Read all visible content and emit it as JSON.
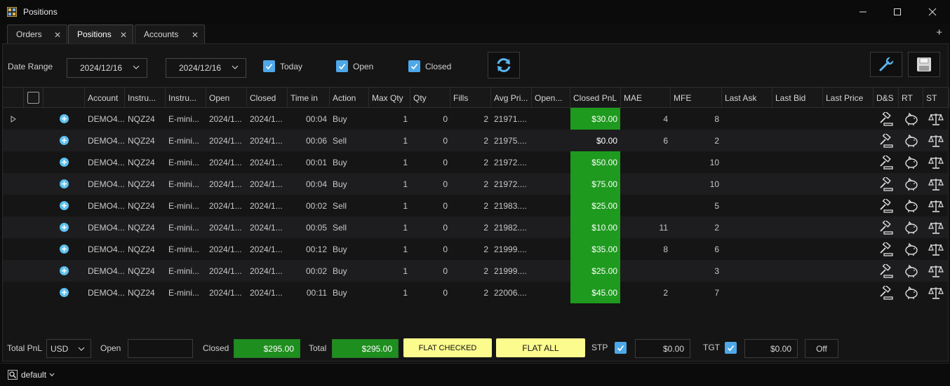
{
  "window": {
    "title": "Positions"
  },
  "tabs": [
    {
      "label": "Orders"
    },
    {
      "label": "Positions"
    },
    {
      "label": "Accounts"
    }
  ],
  "toolbar": {
    "date_range_label": "Date Range",
    "date_from": "2024/12/16",
    "date_to": "2024/12/16",
    "today_label": "Today",
    "open_label": "Open",
    "closed_label": "Closed"
  },
  "columns": [
    "Account",
    "Instru...",
    "Instru...",
    "Open",
    "Closed",
    "Time in",
    "Action",
    "Max Qty",
    "Qty",
    "Fills",
    "Avg Pri...",
    "Open...",
    "Closed PnL",
    "MAE",
    "MFE",
    "Last Ask",
    "Last Bid",
    "Last Price",
    "D&S",
    "RT",
    "ST"
  ],
  "rows": [
    {
      "account": "DEMO4...",
      "instrument": "NQZ24",
      "instrument_name": "E-mini...",
      "open": "2024/1...",
      "closed": "2024/1...",
      "time_in": "00:04",
      "action": "Buy",
      "max_qty": "1",
      "qty": "0",
      "fills": "2",
      "avg_price": "21971....",
      "closed_pnl": "$30.00",
      "mae": "4",
      "mfe": "8",
      "pnl_positive": true
    },
    {
      "account": "DEMO4...",
      "instrument": "NQZ24",
      "instrument_name": "E-mini...",
      "open": "2024/1...",
      "closed": "2024/1...",
      "time_in": "00:06",
      "action": "Sell",
      "max_qty": "1",
      "qty": "0",
      "fills": "2",
      "avg_price": "21975....",
      "closed_pnl": "$0.00",
      "mae": "6",
      "mfe": "2",
      "pnl_positive": false
    },
    {
      "account": "DEMO4...",
      "instrument": "NQZ24",
      "instrument_name": "E-mini...",
      "open": "2024/1...",
      "closed": "2024/1...",
      "time_in": "00:01",
      "action": "Buy",
      "max_qty": "1",
      "qty": "0",
      "fills": "2",
      "avg_price": "21972....",
      "closed_pnl": "$50.00",
      "mae": "",
      "mfe": "10",
      "pnl_positive": true
    },
    {
      "account": "DEMO4...",
      "instrument": "NQZ24",
      "instrument_name": "E-mini...",
      "open": "2024/1...",
      "closed": "2024/1...",
      "time_in": "00:04",
      "action": "Buy",
      "max_qty": "1",
      "qty": "0",
      "fills": "2",
      "avg_price": "21972....",
      "closed_pnl": "$75.00",
      "mae": "",
      "mfe": "10",
      "pnl_positive": true
    },
    {
      "account": "DEMO4...",
      "instrument": "NQZ24",
      "instrument_name": "E-mini...",
      "open": "2024/1...",
      "closed": "2024/1...",
      "time_in": "00:02",
      "action": "Sell",
      "max_qty": "1",
      "qty": "0",
      "fills": "2",
      "avg_price": "21983....",
      "closed_pnl": "$25.00",
      "mae": "",
      "mfe": "5",
      "pnl_positive": true
    },
    {
      "account": "DEMO4...",
      "instrument": "NQZ24",
      "instrument_name": "E-mini...",
      "open": "2024/1...",
      "closed": "2024/1...",
      "time_in": "00:05",
      "action": "Sell",
      "max_qty": "1",
      "qty": "0",
      "fills": "2",
      "avg_price": "21982....",
      "closed_pnl": "$10.00",
      "mae": "11",
      "mfe": "2",
      "pnl_positive": true
    },
    {
      "account": "DEMO4...",
      "instrument": "NQZ24",
      "instrument_name": "E-mini...",
      "open": "2024/1...",
      "closed": "2024/1...",
      "time_in": "00:12",
      "action": "Buy",
      "max_qty": "1",
      "qty": "0",
      "fills": "2",
      "avg_price": "21999....",
      "closed_pnl": "$35.00",
      "mae": "8",
      "mfe": "6",
      "pnl_positive": true
    },
    {
      "account": "DEMO4...",
      "instrument": "NQZ24",
      "instrument_name": "E-mini...",
      "open": "2024/1...",
      "closed": "2024/1...",
      "time_in": "00:02",
      "action": "Buy",
      "max_qty": "1",
      "qty": "0",
      "fills": "2",
      "avg_price": "21999....",
      "closed_pnl": "$25.00",
      "mae": "",
      "mfe": "3",
      "pnl_positive": true
    },
    {
      "account": "DEMO4...",
      "instrument": "NQZ24",
      "instrument_name": "E-mini...",
      "open": "2024/1...",
      "closed": "2024/1...",
      "time_in": "00:11",
      "action": "Buy",
      "max_qty": "1",
      "qty": "0",
      "fills": "2",
      "avg_price": "22006....",
      "closed_pnl": "$45.00",
      "mae": "2",
      "mfe": "7",
      "pnl_positive": true
    }
  ],
  "row_icons": [
    "gavel-icon",
    "piggy-bank-icon",
    "scales-icon"
  ],
  "footer": {
    "total_pnl_label": "Total PnL",
    "currency": "USD",
    "open_label": "Open",
    "open_value": "",
    "closed_label": "Closed",
    "closed_value": "$295.00",
    "total_label": "Total",
    "total_value": "$295.00",
    "flat_checked_label": "FLAT CHECKED",
    "flat_all_label": "FLAT ALL",
    "stp_label": "STP",
    "stp_value": "$0.00",
    "tgt_label": "TGT",
    "tgt_value": "$0.00",
    "off_label": "Off"
  },
  "statusbar": {
    "workspace": "default"
  },
  "colors": {
    "accent": "#4ea8e8",
    "pnl_green": "#1e9a1e",
    "flat_yellow": "#fcfb8e"
  }
}
